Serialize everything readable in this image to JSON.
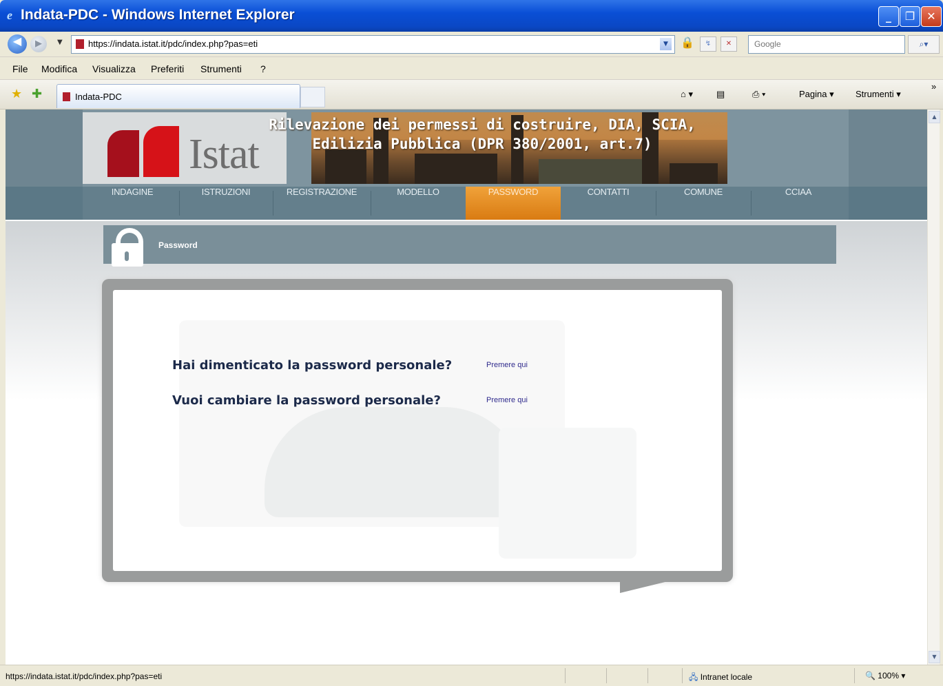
{
  "window": {
    "title": "Indata-PDC - Windows Internet Explorer",
    "minimize_glyph": "_",
    "maximize_glyph": "❐",
    "close_glyph": "✕"
  },
  "addressbar": {
    "url": "https://indata.istat.it/pdc/index.php?pas=eti",
    "search_placeholder": "Google",
    "search_glyph": "⌕▾",
    "feeds_glyph": "↯",
    "stop_glyph": "✕"
  },
  "menu": {
    "file": "File",
    "modifica": "Modifica",
    "visualizza": "Visualizza",
    "preferiti": "Preferiti",
    "strumenti": "Strumenti",
    "help": "?"
  },
  "favbar": {
    "tab_label": "Indata-PDC",
    "cmd_home": "⌂ ▾",
    "cmd_feeds": "▤",
    "cmd_print": "⎙ ▾",
    "cmd_pagina": "Pagina ▾",
    "cmd_strumenti": "Strumenti ▾",
    "more": "»"
  },
  "header": {
    "logo_text": "Istat",
    "banner_title_line1": "Rilevazione dei permessi di costruire, DIA, SCIA,",
    "banner_title_line2": "Edilizia Pubblica (DPR 380/2001, art.7)"
  },
  "nav": {
    "items": [
      {
        "label": "INDAGINE"
      },
      {
        "label": "ISTRUZIONI"
      },
      {
        "label": "REGISTRAZIONE"
      },
      {
        "label": "MODELLO"
      },
      {
        "label": "PASSWORD"
      },
      {
        "label": "CONTATTI"
      },
      {
        "label": "COMUNE"
      },
      {
        "label": "CCIAA"
      }
    ],
    "active_index": 4
  },
  "section": {
    "title": "Password"
  },
  "content": {
    "question1": "Hai dimenticato la password personale?",
    "link1": "Premere qui",
    "question2": "Vuoi cambiare la password personale?",
    "link2": "Premere qui"
  },
  "statusbar": {
    "url": "https://indata.istat.it/pdc/index.php?pas=eti",
    "zone": "Intranet locale",
    "zoom": "100%"
  },
  "colors": {
    "nav_active": "#e08a1e",
    "header": "#7e949f",
    "istat_red": "#d61218"
  }
}
